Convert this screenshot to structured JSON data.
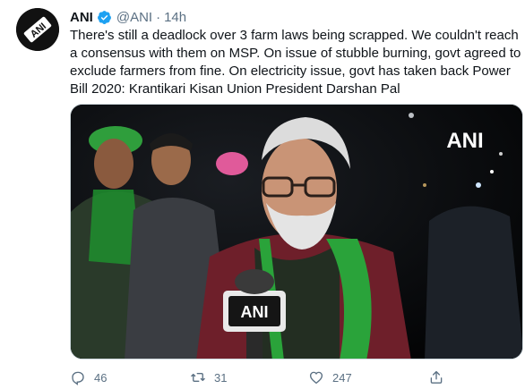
{
  "tweet": {
    "author_name": "ANI",
    "handle": "@ANI",
    "separator": "·",
    "time": "14h",
    "text": "There's still a deadlock over 3 farm laws being scrapped. We couldn't reach a consensus with them on MSP. On issue of stubble burning, govt agreed to exclude farmers from fine. On electricity issue, govt has taken back Power Bill 2020: Krantikari Kisan Union President Darshan Pal",
    "media_watermark": "ANI",
    "mic_logo": "ANI",
    "avatar_logo": "ANI",
    "actions": {
      "reply_count": "46",
      "retweet_count": "31",
      "like_count": "247"
    }
  },
  "icons": {
    "verified": "verified-badge-icon",
    "reply": "reply-icon",
    "retweet": "retweet-icon",
    "like": "heart-icon",
    "share": "share-icon"
  },
  "colors": {
    "verified": "#1da1f2",
    "muted_text": "#5b7083",
    "text": "#0f1419"
  }
}
